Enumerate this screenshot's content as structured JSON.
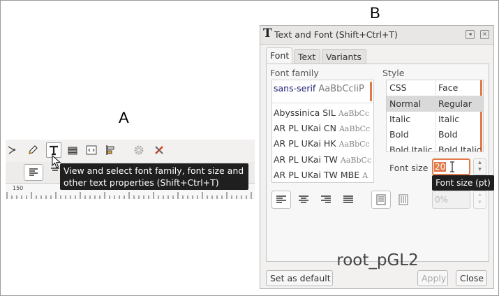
{
  "panel_labels": {
    "a": "A",
    "b": "B"
  },
  "panel_a": {
    "ruler_number": "150",
    "tooltip": {
      "line1": "View and select font family, font size and",
      "line2": "other text properties (Shift+Ctrl+T)"
    },
    "icons": [
      "node-tool-icon",
      "pencil-icon",
      "text-tool-icon",
      "layers-icon",
      "xml-editor-icon",
      "align-icon",
      "gear-icon",
      "tools-icon"
    ]
  },
  "dialog": {
    "title": "Text and Font (Shift+Ctrl+T)",
    "tabs": [
      "Font",
      "Text",
      "Variants"
    ],
    "font_family_label": "Font family",
    "selected_family": {
      "name": "sans-serif",
      "preview": "AaBbCcIiP"
    },
    "families": [
      {
        "name": "Abyssinica SIL",
        "preview": "AaBbCc"
      },
      {
        "name": "AR PL UKai CN",
        "preview": "AaBbCc"
      },
      {
        "name": "AR PL UKai HK",
        "preview": "AaBbCc"
      },
      {
        "name": "AR PL UKai TW",
        "preview": "AaBbCc"
      },
      {
        "name": "AR PL UKai TW MBE",
        "preview": "A"
      }
    ],
    "style_label": "Style",
    "style_columns": [
      "CSS",
      "Face"
    ],
    "styles": [
      {
        "css": "Normal",
        "face": "Regular",
        "selected": true
      },
      {
        "css": "Italic",
        "face": "Italic",
        "selected": false
      },
      {
        "css": "Bold",
        "face": "Bold",
        "selected": false
      },
      {
        "css": "Bold Italic",
        "face": "Bold Italic",
        "selected": false
      }
    ],
    "font_size_label": "Font size",
    "font_size_value": "20",
    "font_size_tooltip": "Font size (pt)",
    "line_spacing_value": "0%",
    "preview_text": "root_pGL2",
    "buttons": {
      "set_default": "Set as default",
      "apply": "Apply",
      "close": "Close"
    },
    "accent_color": "#e07a4a"
  }
}
